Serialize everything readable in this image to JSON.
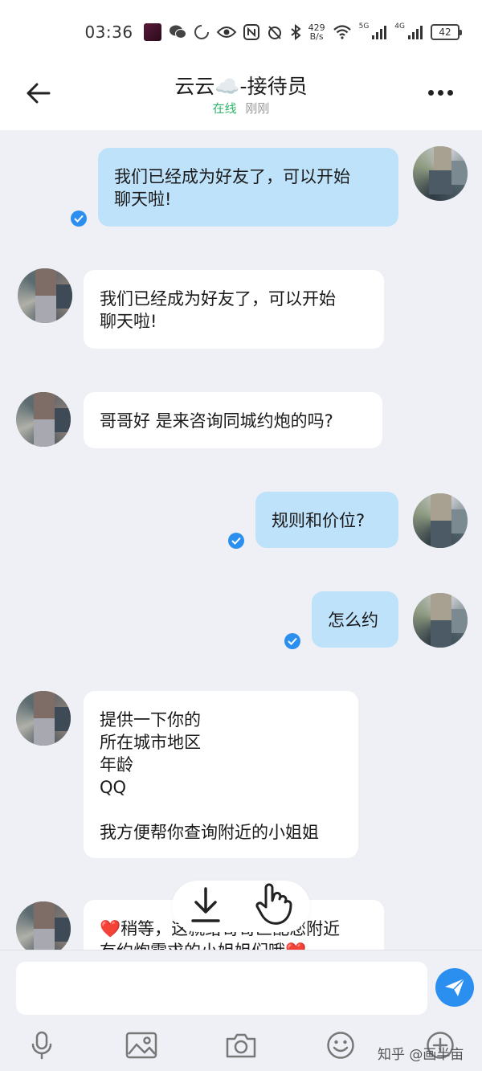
{
  "status_bar": {
    "time": "03:36",
    "net_rate_top": "429",
    "net_rate_unit": "B/s",
    "net1": "5G",
    "net2": "4G",
    "battery": "42"
  },
  "header": {
    "title": "云云☁️-接待员",
    "status": "在线",
    "last_seen": "刚刚"
  },
  "messages": [
    {
      "from": "me",
      "text": "我们已经成为好友了，可以开始\n聊天啦!",
      "read": true
    },
    {
      "from": "them",
      "text": "我们已经成为好友了，可以开始\n聊天啦!"
    },
    {
      "from": "them",
      "text": "哥哥好 是来咨询同城约炮的吗?"
    },
    {
      "from": "me",
      "text": "规则和价位?",
      "read": true
    },
    {
      "from": "me",
      "text": "怎么约",
      "read": true
    },
    {
      "from": "them",
      "text": "提供一下你的\n所在城市地区\n年龄\nQQ\n\n我方便帮你查询附近的小姐姐"
    },
    {
      "from": "them",
      "text": "❤️稍等，这就给哥哥匹配您附近\n有约炮需求的小姐姐们哦❤️"
    }
  ],
  "input": {
    "placeholder": ""
  },
  "watermark": "知乎 @画半亩",
  "icons": [
    "back-arrow-icon",
    "more-icon",
    "download-icon",
    "hand-pointer-icon",
    "send-icon",
    "microphone-icon",
    "image-icon",
    "camera-icon",
    "emoji-icon",
    "plus-icon"
  ]
}
